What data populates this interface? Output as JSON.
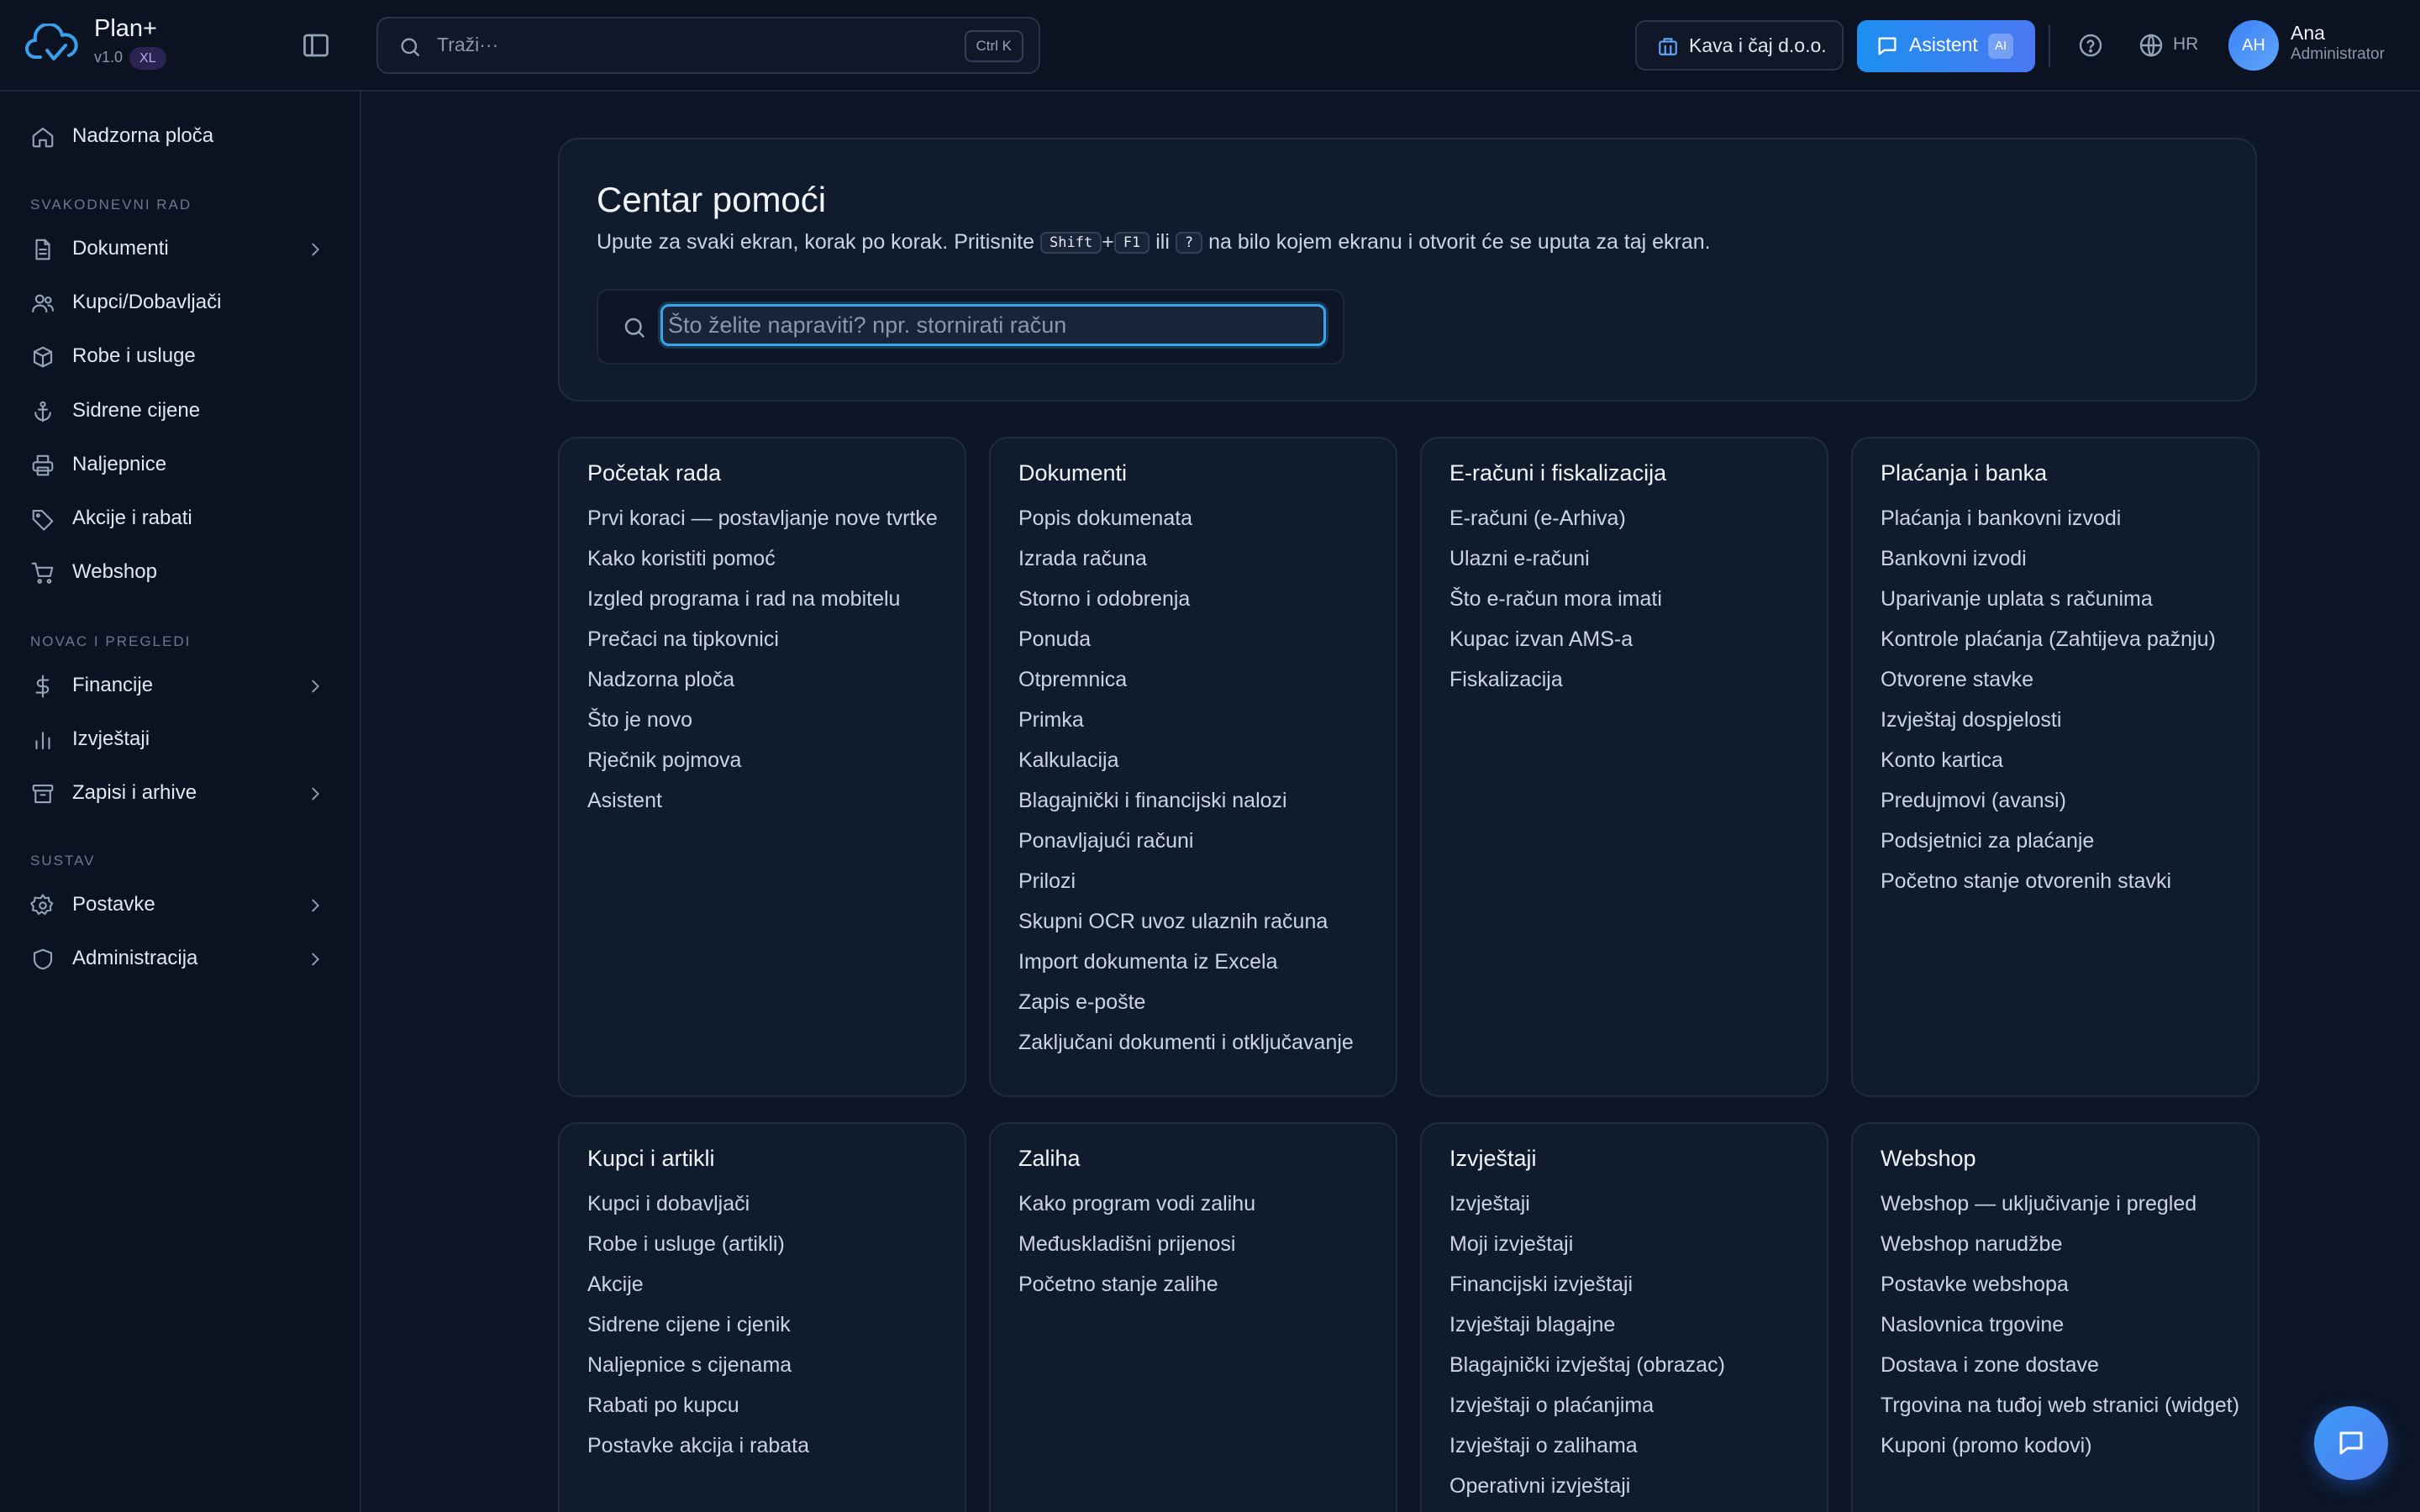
{
  "app": {
    "name": "Plan+",
    "version": "v1.0",
    "badge": "XL"
  },
  "header": {
    "search_placeholder": "Traži···",
    "search_shortcut": "Ctrl K",
    "company": "Kava i čaj d.o.o.",
    "assistant_label": "Asistent",
    "assistant_badge": "AI",
    "language": "HR",
    "user": {
      "initials": "AH",
      "name": "Ana",
      "role": "Administrator"
    },
    "icons": [
      "cloud-logo-icon",
      "sidebar-toggle-icon",
      "search-icon",
      "building-icon",
      "chat-icon",
      "help-circle-icon",
      "globe-icon"
    ]
  },
  "sidebar": {
    "top": {
      "label": "Nadzorna ploča",
      "icon": "home-icon"
    },
    "sections": [
      {
        "title": "SVAKODNEVNI RAD",
        "items": [
          {
            "label": "Dokumenti",
            "icon": "file-icon",
            "expandable": true
          },
          {
            "label": "Kupci/Dobavljači",
            "icon": "users-icon",
            "expandable": false
          },
          {
            "label": "Robe i usluge",
            "icon": "box-icon",
            "expandable": false
          },
          {
            "label": "Sidrene cijene",
            "icon": "anchor-icon",
            "expandable": false
          },
          {
            "label": "Naljepnice",
            "icon": "printer-icon",
            "expandable": false
          },
          {
            "label": "Akcije i rabati",
            "icon": "tag-icon",
            "expandable": false
          },
          {
            "label": "Webshop",
            "icon": "cart-icon",
            "expandable": false
          }
        ]
      },
      {
        "title": "NOVAC I PREGLEDI",
        "items": [
          {
            "label": "Financije",
            "icon": "dollar-icon",
            "expandable": true
          },
          {
            "label": "Izvještaji",
            "icon": "bar-chart-icon",
            "expandable": false
          },
          {
            "label": "Zapisi i arhive",
            "icon": "archive-icon",
            "expandable": true
          }
        ]
      },
      {
        "title": "SUSTAV",
        "items": [
          {
            "label": "Postavke",
            "icon": "gear-icon",
            "expandable": true
          },
          {
            "label": "Administracija",
            "icon": "shield-icon",
            "expandable": true
          }
        ]
      }
    ]
  },
  "hero": {
    "title": "Centar pomoći",
    "desc_before": "Upute za svaki ekran, korak po korak. Pritisnite",
    "key_shift": "Shift",
    "key_plus": "+",
    "key_f1": "F1",
    "desc_or": "ili",
    "key_question": "?",
    "desc_after": "na bilo kojem ekranu i otvorit će se uputa za taj ekran.",
    "search_placeholder": "Što želite napraviti? npr. stornirati račun",
    "search_value": ""
  },
  "cards": [
    {
      "title": "Početak rada",
      "links": [
        "Prvi koraci — postavljanje nove tvrtke",
        "Kako koristiti pomoć",
        "Izgled programa i rad na mobitelu",
        "Prečaci na tipkovnici",
        "Nadzorna ploča",
        "Što je novo",
        "Rječnik pojmova",
        "Asistent"
      ]
    },
    {
      "title": "Dokumenti",
      "links": [
        "Popis dokumenata",
        "Izrada računa",
        "Storno i odobrenja",
        "Ponuda",
        "Otpremnica",
        "Primka",
        "Kalkulacija",
        "Blagajnički i financijski nalozi",
        "Ponavljajući računi",
        "Prilozi",
        "Skupni OCR uvoz ulaznih računa",
        "Import dokumenta iz Excela",
        "Zapis e-pošte",
        "Zaključani dokumenti i otključavanje"
      ]
    },
    {
      "title": "E-računi i fiskalizacija",
      "links": [
        "E-računi (e-Arhiva)",
        "Ulazni e-računi",
        "Što e-račun mora imati",
        "Kupac izvan AMS-a",
        "Fiskalizacija"
      ]
    },
    {
      "title": "Plaćanja i banka",
      "links": [
        "Plaćanja i bankovni izvodi",
        "Bankovni izvodi",
        "Uparivanje uplata s računima",
        "Kontrole plaćanja (Zahtijeva pažnju)",
        "Otvorene stavke",
        "Izvještaj dospjelosti",
        "Konto kartica",
        "Predujmovi (avansi)",
        "Podsjetnici za plaćanje",
        "Početno stanje otvorenih stavki"
      ]
    },
    {
      "title": "Kupci i artikli",
      "links": [
        "Kupci i dobavljači",
        "Robe i usluge (artikli)",
        "Akcije",
        "Sidrene cijene i cjenik",
        "Naljepnice s cijenama",
        "Rabati po kupcu",
        "Postavke akcija i rabata"
      ]
    },
    {
      "title": "Zaliha",
      "links": [
        "Kako program vodi zalihu",
        "Međuskladišni prijenosi",
        "Početno stanje zalihe"
      ]
    },
    {
      "title": "Izvještaji",
      "links": [
        "Izvještaji",
        "Moji izvještaji",
        "Financijski izvještaji",
        "Izvještaji blagajne",
        "Blagajnički izvještaj (obrazac)",
        "Izvještaji o plaćanjima",
        "Izvještaji o zalihama",
        "Operativni izvještaji"
      ]
    },
    {
      "title": "Webshop",
      "links": [
        "Webshop — uključivanje i pregled",
        "Webshop narudžbe",
        "Postavke webshopa",
        "Naslovnica trgovine",
        "Dostava i zone dostave",
        "Trgovina na tuđoj web stranici (widget)",
        "Kuponi (promo kodovi)"
      ]
    }
  ],
  "fab": {
    "icon": "chat-icon"
  }
}
